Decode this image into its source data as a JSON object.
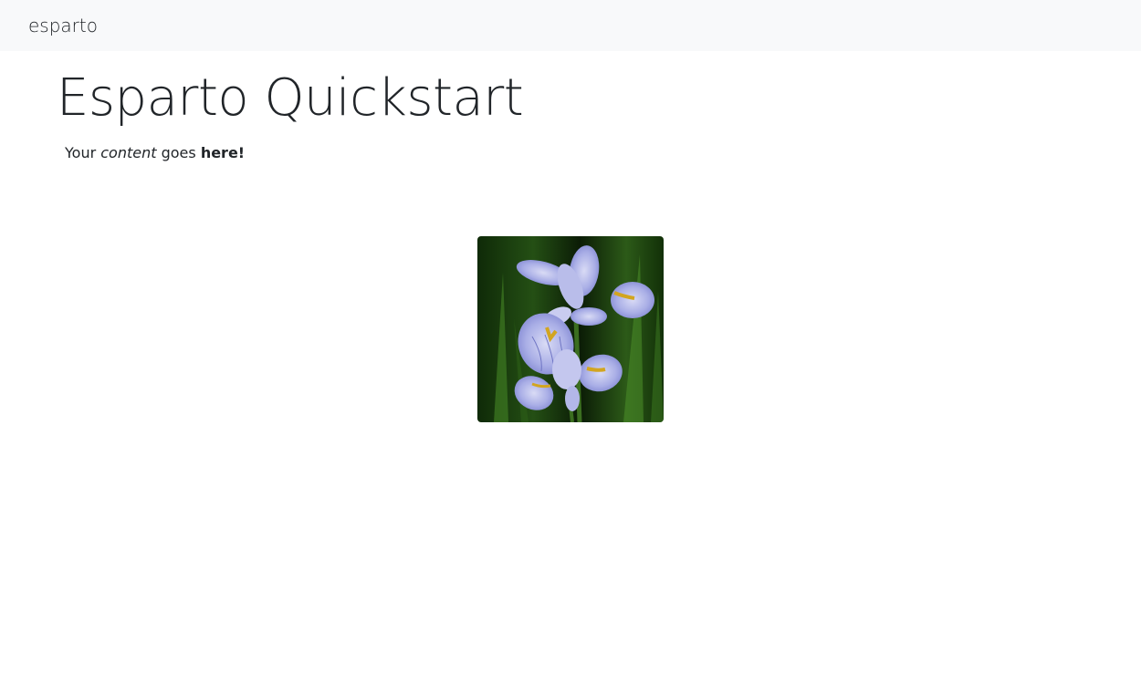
{
  "navbar": {
    "brand": "esparto"
  },
  "main": {
    "title": "Esparto Quickstart",
    "paragraph": {
      "part1": "Your ",
      "italic": "content",
      "part2": " goes ",
      "bold": "here!"
    },
    "image": {
      "icon": "iris-flower-photo",
      "colors": {
        "background": "#1c3d10",
        "petal": "#a9aee6",
        "petal_vein": "#6f75c4",
        "accent": "#d2a520"
      }
    }
  }
}
